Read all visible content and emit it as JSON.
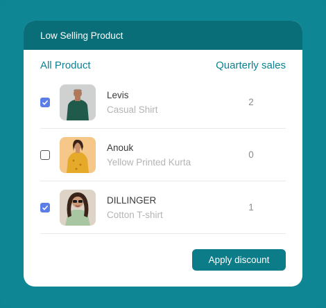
{
  "widget": {
    "title": "Low Selling Product",
    "columns": {
      "product": "All Product",
      "sales": "Quarterly sales"
    },
    "rows": [
      {
        "brand": "Levis",
        "product": "Casual Shirt",
        "sales": "2",
        "checked": true
      },
      {
        "brand": "Anouk",
        "product": "Yellow Printed Kurta",
        "sales": "0",
        "checked": false
      },
      {
        "brand": "DILLINGER",
        "product": "Cotton T-shirt",
        "sales": "1",
        "checked": true
      }
    ],
    "action_label": "Apply discount"
  },
  "colors": {
    "background": "#0f8694",
    "header": "#0a6e79",
    "accent": "#0b8192",
    "checkbox": "#5b7de6"
  }
}
